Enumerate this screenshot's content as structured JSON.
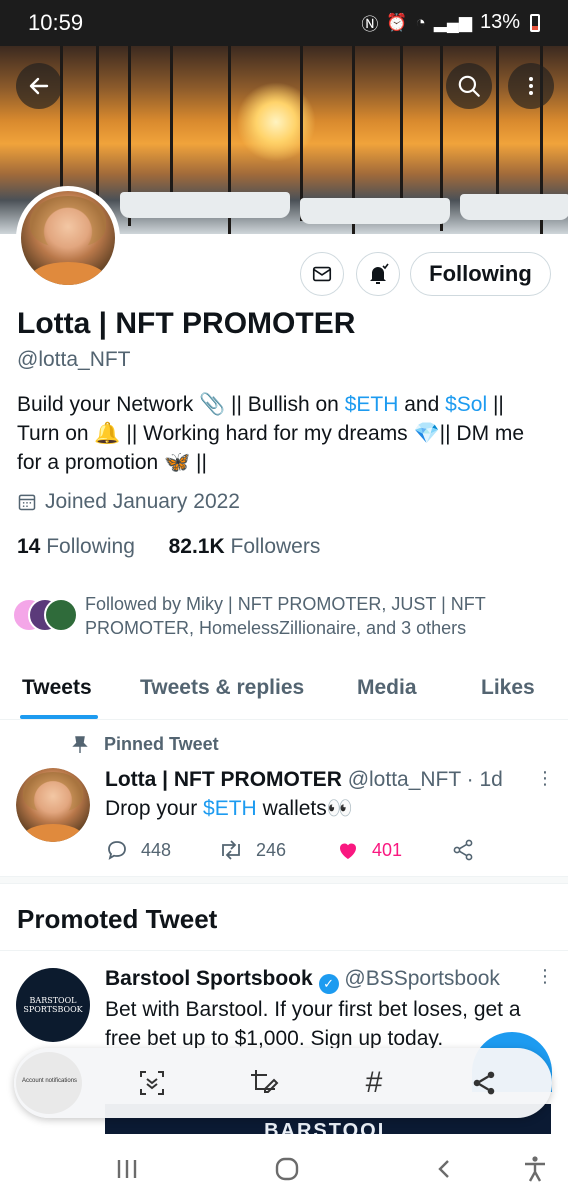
{
  "status_bar": {
    "time": "10:59",
    "battery": "13%"
  },
  "profile": {
    "display_name": "Lotta | NFT PROMOTER",
    "handle": "@lotta_NFT",
    "bio": {
      "line1_a": "Build your Network 📎 || Bullish on ",
      "eth": "$ETH",
      "line1_b": " and ",
      "sol": "$Sol",
      "line1_c": " ||",
      "line2": "Turn on 🔔 || Working hard for my dreams 💎|| DM me",
      "line3": "for a promotion 🦋 ||"
    },
    "joined": "Joined January 2022",
    "following_count": "14",
    "following_label": "Following",
    "followers_count": "82.1K",
    "followers_label": "Followers",
    "followed_by": "Followed by Miky | NFT PROMOTER, JUST | NFT PROMOTER, HomelessZillionaire, and 3 others",
    "follow_button": "Following"
  },
  "tabs": [
    {
      "label": "Tweets",
      "active": true
    },
    {
      "label": "Tweets & replies",
      "active": false
    },
    {
      "label": "Media",
      "active": false
    },
    {
      "label": "Likes",
      "active": false
    }
  ],
  "pinned_tweet": {
    "pinned_label": "Pinned Tweet",
    "author": "Lotta | NFT PROMOTER",
    "handle_time": "@lotta_NFT · 1d",
    "text_a": "Drop your ",
    "text_link": "$ETH",
    "text_b": " wallets👀",
    "replies": "448",
    "retweets": "246",
    "likes": "401"
  },
  "promoted": {
    "section_title": "Promoted Tweet",
    "author": "Barstool Sportsbook",
    "handle": "@BSSportsbook",
    "avatar_text": "BARSTOOL SPORTSBOOK",
    "text": "Bet with Barstool. If your first bet loses, get a free bet up to $1,000. Sign up today.",
    "media_text": "BARSTOOL"
  },
  "toolbar": {
    "thumb_caption": "Account notifications"
  },
  "colors": {
    "accent": "#1d9bf0",
    "like": "#f91880",
    "secondary_text": "#536471"
  }
}
